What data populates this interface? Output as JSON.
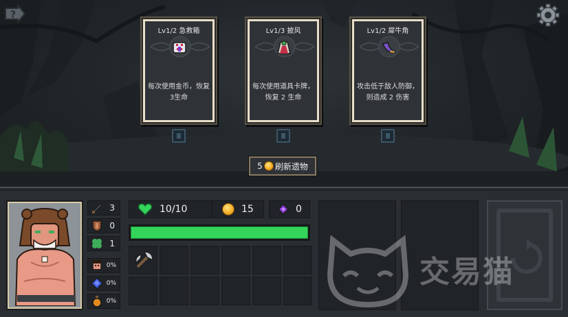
{
  "relics": [
    {
      "title": "Lv1/2 急救箱",
      "desc_line1": "每次使用金币，恢复",
      "desc_line2": "3生命",
      "icon": "first-aid-kit-icon"
    },
    {
      "title": "Lv1/3 披风",
      "desc_line1": "每次使用道具卡牌，",
      "desc_line2": "恢复 2 生命",
      "icon": "cloak-icon"
    },
    {
      "title": "Lv1/2 犀牛角",
      "desc_line1": "攻击低于敌人防御，",
      "desc_line2": "则造成 2 伤害",
      "icon": "rhino-horn-icon"
    }
  ],
  "refresh": {
    "cost": "5",
    "label": "刷新遗物"
  },
  "stats": {
    "attack": "3",
    "defense": "0",
    "luck": "1",
    "rage": "0%",
    "gem": "0%",
    "potion": "0%"
  },
  "resources": {
    "hp": "10/10",
    "gold": "15",
    "crystal": "0"
  },
  "hp_fraction": 1.0,
  "inventory": {
    "slot1": "axe-icon"
  },
  "watermark": {
    "text": "交易猫"
  },
  "colors": {
    "hp_green": "#33d45a",
    "coin_gold": "#f6b02a",
    "crystal_purple": "#8b3fd6"
  }
}
